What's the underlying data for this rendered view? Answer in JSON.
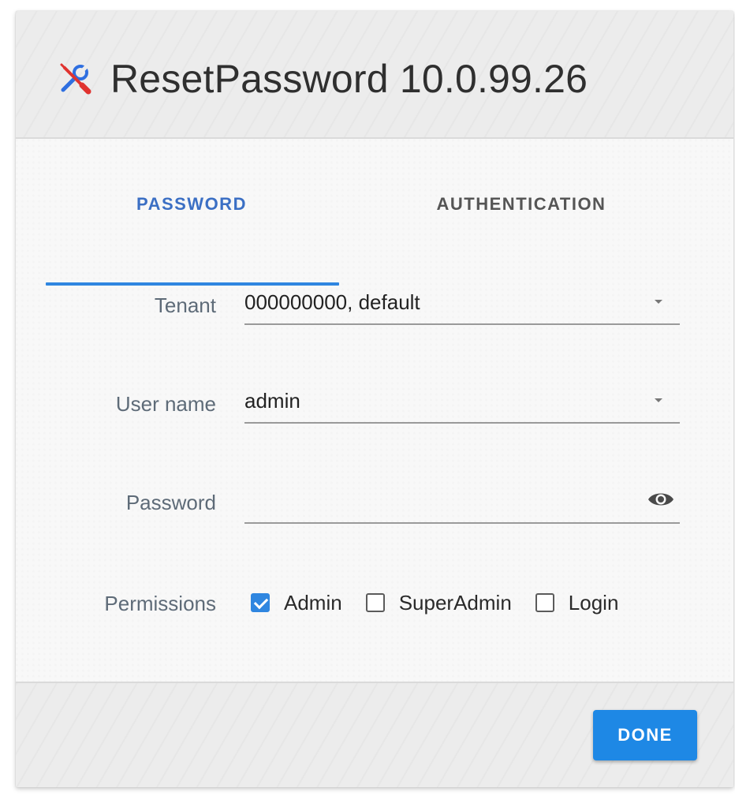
{
  "dialog": {
    "title": "ResetPassword 10.0.99.26",
    "title_icon": "tools-icon"
  },
  "tabs": [
    {
      "label": "PASSWORD",
      "active": true
    },
    {
      "label": "AUTHENTICATION",
      "active": false
    }
  ],
  "form": {
    "tenant": {
      "label": "Tenant",
      "value": "000000000, default"
    },
    "username": {
      "label": "User name",
      "value": "admin"
    },
    "password": {
      "label": "Password",
      "value": "",
      "icon": "eye-icon"
    },
    "permissions": {
      "label": "Permissions",
      "options": [
        {
          "label": "Admin",
          "checked": true
        },
        {
          "label": "SuperAdmin",
          "checked": false
        },
        {
          "label": "Login",
          "checked": false
        }
      ]
    }
  },
  "footer": {
    "done_label": "DONE"
  },
  "colors": {
    "accent": "#1e88e5",
    "active_tab": "#3b6fc4",
    "icon_blue": "#2f6fe0",
    "icon_red": "#e0332f"
  }
}
